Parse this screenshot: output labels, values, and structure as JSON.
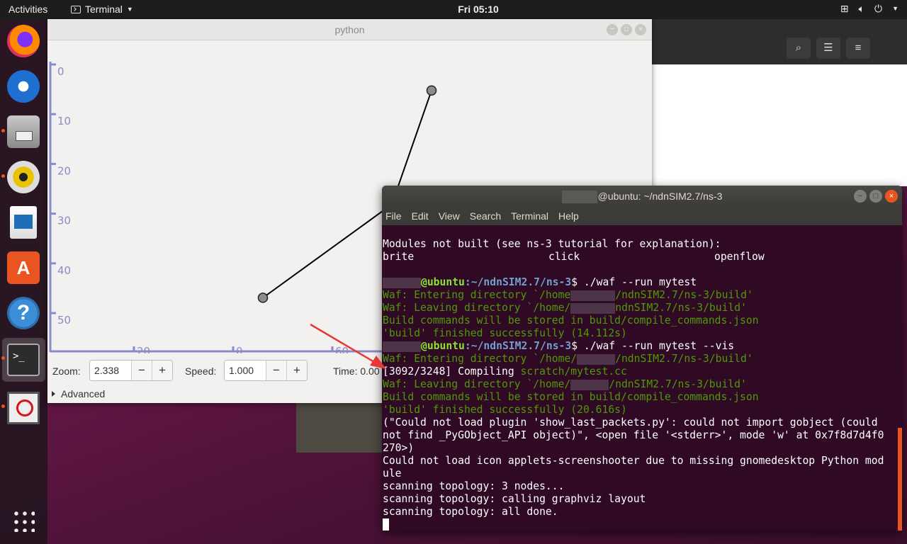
{
  "topbar": {
    "activities": "Activities",
    "app_name": "Terminal",
    "clock": "Fri 05:10"
  },
  "dock": {
    "items": [
      "firefox-icon",
      "thunderbird-icon",
      "files-icon",
      "rhythmbox-icon",
      "libreoffice-writer-icon",
      "software-center-icon",
      "help-icon",
      "terminal-icon",
      "stop-sign-icon",
      "show-applications-icon"
    ]
  },
  "python_window": {
    "title": "python",
    "zoom_label": "Zoom:",
    "zoom_value": "2.338",
    "speed_label": "Speed:",
    "speed_value": "1.000",
    "time_label": "Time: 0.00",
    "advanced_label": "Advanced",
    "minus": "−",
    "plus": "+"
  },
  "chart_data": {
    "type": "line",
    "yticks": [
      "0",
      "10",
      "20",
      "30",
      "40",
      "50"
    ],
    "xticks_partial": [
      "20",
      "0",
      "60"
    ],
    "points": [
      {
        "x": 46,
        "y": 46.5
      },
      {
        "x": 72,
        "y": 27.7
      },
      {
        "x": 80,
        "y": 4.8
      }
    ],
    "ylim": [
      0,
      56
    ],
    "xlim": [
      12,
      130
    ]
  },
  "terminal_window": {
    "title": "@ubuntu: ~/ndnSIM2.7/ns-3",
    "menu": [
      "File",
      "Edit",
      "View",
      "Search",
      "Terminal",
      "Help"
    ],
    "lines": {
      "l1": "Modules not built (see ns-3 tutorial for explanation):",
      "l2a": "brite",
      "l2b": "click",
      "l2c": "openflow",
      "p1_host": "@ubuntu",
      "p1_path": ":~/ndnSIM2.7/ns-3",
      "p1_cmd": "$ ./waf --run mytest",
      "l4a": "Waf: Entering directory `/home",
      "l4b": "/ndnSIM2.7/ns-3/build'",
      "l5a": "Waf: Leaving directory `/home/",
      "l5b": "ndnSIM2.7/ns-3/build'",
      "l6": "Build commands will be stored in build/compile_commands.json",
      "l7": "'build' finished successfully (14.112s)",
      "p2_host": "@ubuntu",
      "p2_path": ":~/ndnSIM2.7/ns-3",
      "p2_cmd": "$ ./waf --run mytest --vis",
      "l9a": "Waf: Entering directory `/home/",
      "l9b": "/ndnSIM2.7/ns-3/build'",
      "l10a": "[3092/3248] Compiling ",
      "l10b": "scratch/mytest.cc",
      "l11a": "Waf: Leaving directory `/home/",
      "l11b": "/ndnSIM2.7/ns-3/build'",
      "l12": "Build commands will be stored in build/compile_commands.json",
      "l13": "'build' finished successfully (20.616s)",
      "l14": "(\"Could not load plugin 'show_last_packets.py': could not import gobject (could",
      "l15": "not find _PyGObject_API object)\", <open file '<stderr>', mode 'w' at 0x7f8d7d4f0",
      "l16": "270>)",
      "l17": "Could not load icon applets-screenshooter due to missing gnomedesktop Python mod",
      "l18": "ule",
      "l19": "scanning topology: 3 nodes...",
      "l20": "scanning topology: calling graphviz layout",
      "l21": "scanning topology: all done."
    }
  },
  "colors": {
    "ubuntu_orange": "#e95420",
    "terminal_bg": "#300a24",
    "prompt_green": "#8ae234",
    "prompt_blue": "#729fcf",
    "waf_green": "#4e9a06",
    "axis_color": "#8a8acb",
    "arrow_red": "#e53935"
  }
}
